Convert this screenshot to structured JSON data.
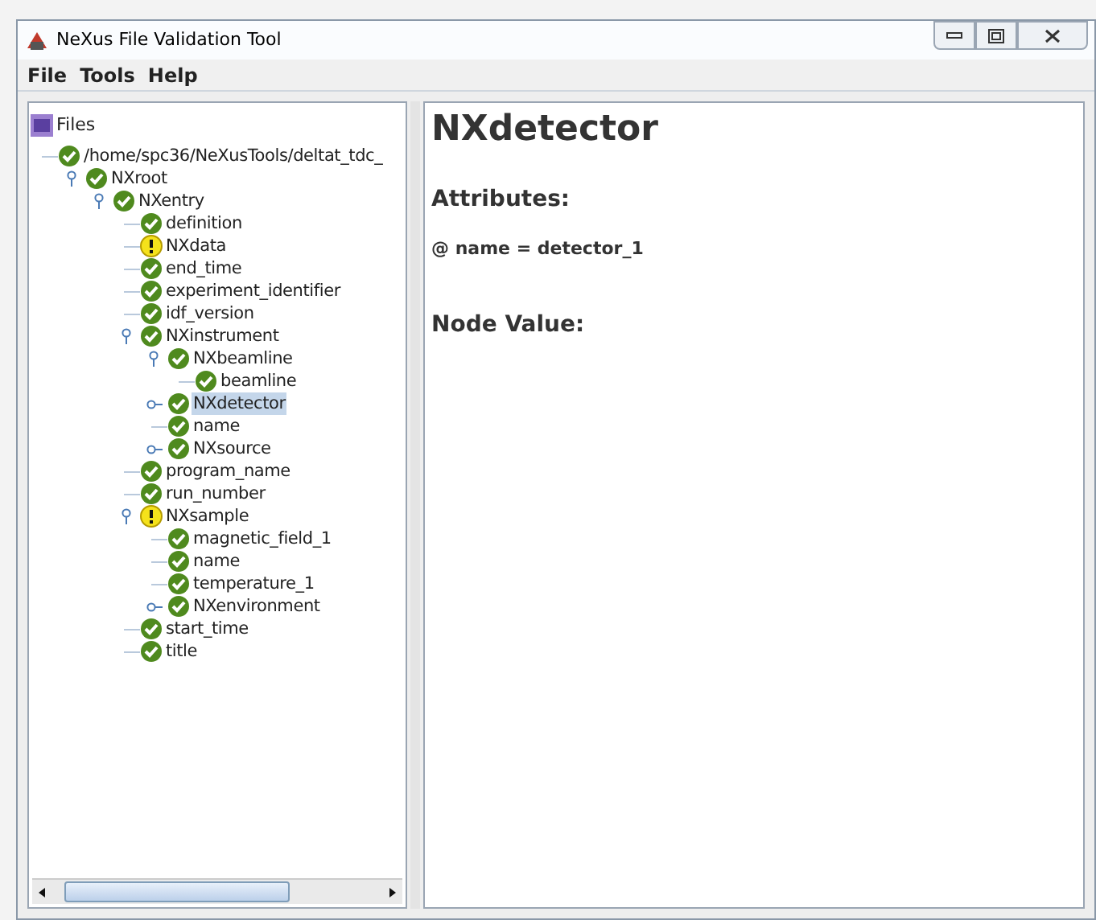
{
  "window": {
    "title": "NeXus File Validation Tool"
  },
  "menu": [
    "File",
    "Tools",
    "Help"
  ],
  "tree": {
    "title": "Files",
    "nodes": [
      {
        "label": "/home/spc36/NeXusTools/deltat_tdc_",
        "kind": "ok",
        "selected": false,
        "children": [
          {
            "label": "NXroot",
            "kind": "ok",
            "selected": false,
            "expanded": true,
            "children": [
              {
                "label": "NXentry",
                "kind": "ok",
                "selected": false,
                "expanded": true,
                "children": [
                  {
                    "label": "definition",
                    "kind": "ok",
                    "selected": false
                  },
                  {
                    "label": "NXdata",
                    "kind": "warn",
                    "selected": false
                  },
                  {
                    "label": "end_time",
                    "kind": "ok",
                    "selected": false
                  },
                  {
                    "label": "experiment_identifier",
                    "kind": "ok",
                    "selected": false
                  },
                  {
                    "label": "idf_version",
                    "kind": "ok",
                    "selected": false
                  },
                  {
                    "label": "NXinstrument",
                    "kind": "ok",
                    "selected": false,
                    "expanded": true,
                    "children": [
                      {
                        "label": "NXbeamline",
                        "kind": "ok",
                        "selected": false,
                        "expanded": true,
                        "children": [
                          {
                            "label": "beamline",
                            "kind": "ok",
                            "selected": false
                          }
                        ]
                      },
                      {
                        "label": "NXdetector",
                        "kind": "ok",
                        "selected": true,
                        "expanded": false
                      },
                      {
                        "label": "name",
                        "kind": "ok",
                        "selected": false
                      },
                      {
                        "label": "NXsource",
                        "kind": "ok",
                        "selected": false,
                        "expanded": false
                      }
                    ]
                  },
                  {
                    "label": "program_name",
                    "kind": "ok",
                    "selected": false
                  },
                  {
                    "label": "run_number",
                    "kind": "ok",
                    "selected": false
                  },
                  {
                    "label": "NXsample",
                    "kind": "warn",
                    "selected": false,
                    "expanded": true,
                    "children": [
                      {
                        "label": "magnetic_field_1",
                        "kind": "ok",
                        "selected": false
                      },
                      {
                        "label": "name",
                        "kind": "ok",
                        "selected": false
                      },
                      {
                        "label": "temperature_1",
                        "kind": "ok",
                        "selected": false
                      },
                      {
                        "label": "NXenvironment",
                        "kind": "ok",
                        "selected": false,
                        "expanded": false
                      }
                    ]
                  },
                  {
                    "label": "start_time",
                    "kind": "ok",
                    "selected": false
                  },
                  {
                    "label": "title",
                    "kind": "ok",
                    "selected": false
                  }
                ]
              }
            ]
          }
        ]
      }
    ]
  },
  "detail": {
    "title": "NXdetector",
    "attributes_heading": "Attributes:",
    "attributes": [
      "@ name = detector_1"
    ],
    "node_value_heading": "Node Value:"
  }
}
